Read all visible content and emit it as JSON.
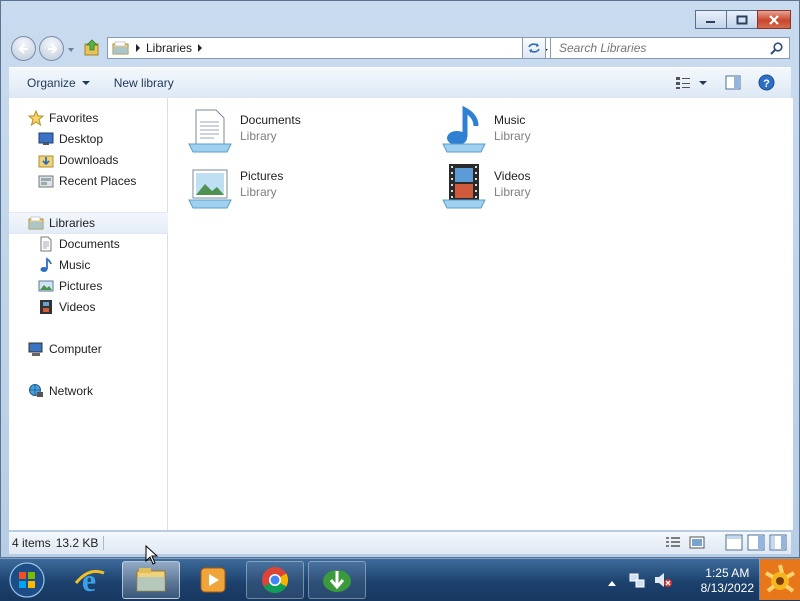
{
  "address": {
    "crumbs": [
      "Libraries"
    ]
  },
  "search": {
    "placeholder": "Search Libraries"
  },
  "toolbar": {
    "organize": "Organize",
    "new_library": "New library"
  },
  "nav": {
    "favorites": "Favorites",
    "favorite_items": [
      "Desktop",
      "Downloads",
      "Recent Places"
    ],
    "libraries": "Libraries",
    "library_items": [
      "Documents",
      "Music",
      "Pictures",
      "Videos"
    ],
    "computer": "Computer",
    "network": "Network"
  },
  "libraries": [
    {
      "name": "Documents",
      "type": "Library",
      "icon": "documents-library-icon"
    },
    {
      "name": "Music",
      "type": "Library",
      "icon": "music-library-icon"
    },
    {
      "name": "Pictures",
      "type": "Library",
      "icon": "pictures-library-icon"
    },
    {
      "name": "Videos",
      "type": "Library",
      "icon": "videos-library-icon"
    }
  ],
  "status": {
    "items": "4 items",
    "size": "13.2 KB"
  },
  "clock": {
    "time": "1:25 AM",
    "date": "8/13/2022"
  },
  "taskbar": [
    "start-orb",
    "internet-explorer",
    "windows-explorer",
    "windows-media-player",
    "chrome",
    "internet-download-manager"
  ],
  "colors": {
    "accent": "#1e395b",
    "taskbar": "#1d426e",
    "close": "#c8462c"
  }
}
